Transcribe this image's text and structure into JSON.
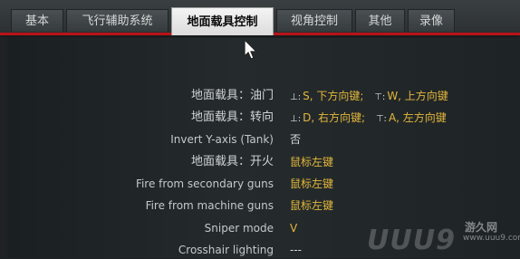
{
  "tabs": [
    {
      "label": "基本"
    },
    {
      "label": "飞行辅助系统"
    },
    {
      "label": "地面载具控制",
      "active": true
    },
    {
      "label": "视角控制"
    },
    {
      "label": "其他"
    },
    {
      "label": "录像"
    }
  ],
  "rows": [
    {
      "label": "地面载具：油门",
      "value_a_icon": "⊥:",
      "value_a": "S, 下方向键;",
      "value_b_icon": "⊤:",
      "value_b": "W, 上方向键"
    },
    {
      "label": "地面载具：转向",
      "value_a_icon": "⊥:",
      "value_a": "D, 右方向键;",
      "value_b_icon": "⊤:",
      "value_b": "A, 左方向键"
    },
    {
      "label": "Invert Y-axis (Tank)",
      "value": "否"
    },
    {
      "label": "地面载具：开火",
      "value": "鼠标左键"
    },
    {
      "label": "Fire from secondary guns",
      "value": "鼠标左键"
    },
    {
      "label": "Fire from machine guns",
      "value": "鼠标左键"
    },
    {
      "label": "Sniper mode",
      "value": "V"
    },
    {
      "label": "Crosshair lighting",
      "value": "---"
    }
  ],
  "watermark": {
    "logo": "UUU9",
    "site": "游久网",
    "url": "www.uuu9.com"
  },
  "colors": {
    "accent_red": "#b8141a",
    "value_gold": "#e3b73b"
  }
}
